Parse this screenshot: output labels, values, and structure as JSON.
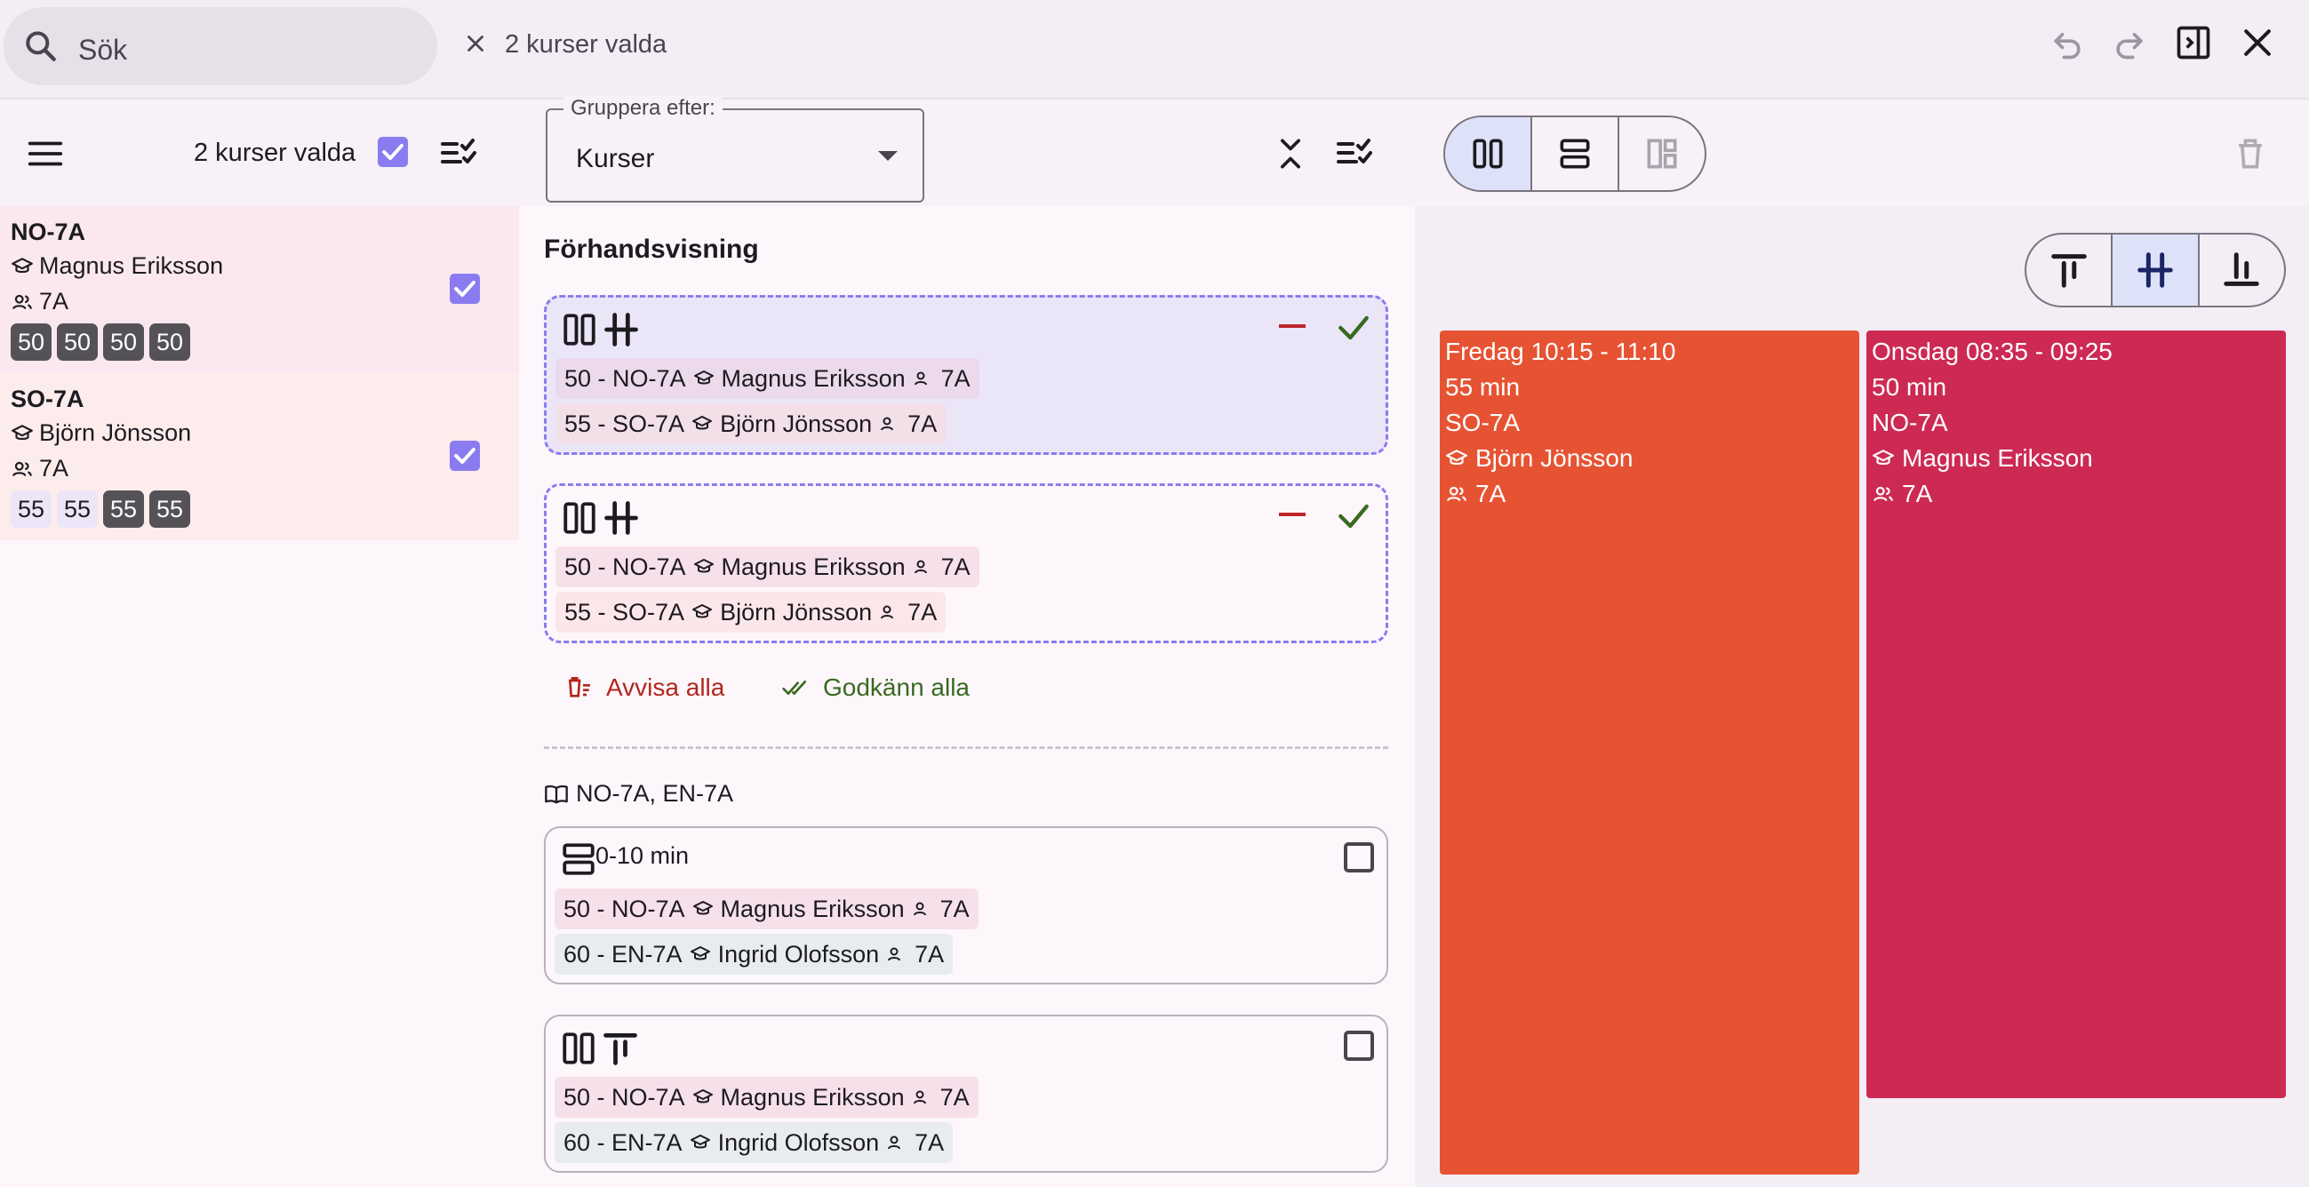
{
  "search": {
    "placeholder": "Sök"
  },
  "selection_chip": {
    "label": "2 kurser valda"
  },
  "toolbar": {
    "selected_label": "2 kurser valda",
    "group_by_label": "Gruppera efter:",
    "group_by_value": "Kurser"
  },
  "courses": [
    {
      "name": "NO-7A",
      "teacher": "Magnus Eriksson",
      "group": "7A",
      "pills": [
        "50",
        "50",
        "50",
        "50"
      ],
      "bg": "#fbe8ee",
      "pill_styles": [
        "dark",
        "dark",
        "dark",
        "dark"
      ]
    },
    {
      "name": "SO-7A",
      "teacher": "Björn Jönsson",
      "group": "7A",
      "pills": [
        "55",
        "55",
        "55",
        "55"
      ],
      "bg": "#fcecec",
      "pill_styles": [
        "light",
        "light",
        "dark",
        "dark"
      ]
    }
  ],
  "preview": {
    "title": "Förhandsvisning",
    "proposals": [
      {
        "lessons": [
          {
            "text": "50 - NO-7A",
            "teacher": "Magnus Eriksson",
            "group": "7A"
          },
          {
            "text": "55 - SO-7A",
            "teacher": "Björn Jönsson",
            "group": "7A"
          }
        ]
      },
      {
        "lessons": [
          {
            "text": "50 - NO-7A",
            "teacher": "Magnus Eriksson",
            "group": "7A"
          },
          {
            "text": "55 - SO-7A",
            "teacher": "Björn Jönsson",
            "group": "7A"
          }
        ]
      }
    ],
    "reject_all": "Avvisa alla",
    "approve_all": "Godkänn alla"
  },
  "group_section": {
    "title": "NO-7A, EN-7A",
    "options": [
      {
        "label": "0-10 min",
        "lessons": [
          {
            "text": "50 - NO-7A",
            "teacher": "Magnus Eriksson",
            "group": "7A"
          },
          {
            "text": "60 - EN-7A",
            "teacher": "Ingrid Olofsson",
            "group": "7A"
          }
        ]
      },
      {
        "label": "",
        "lessons": [
          {
            "text": "50 - NO-7A",
            "teacher": "Magnus Eriksson",
            "group": "7A"
          },
          {
            "text": "60 - EN-7A",
            "teacher": "Ingrid Olofsson",
            "group": "7A"
          }
        ]
      }
    ]
  },
  "calendar": {
    "events": [
      {
        "time": "Fredag 10:15 - 11:10",
        "duration": "55 min",
        "course": "SO-7A",
        "teacher": "Björn Jönsson",
        "group": "7A",
        "color": "#e65333"
      },
      {
        "time": "Onsdag 08:35 - 09:25",
        "duration": "50 min",
        "course": "NO-7A",
        "teacher": "Magnus Eriksson",
        "group": "7A",
        "color": "#cc2a53"
      }
    ]
  },
  "colors": {
    "accent": "#8a7cf0",
    "approve": "#386a20",
    "reject": "#b3261e"
  }
}
